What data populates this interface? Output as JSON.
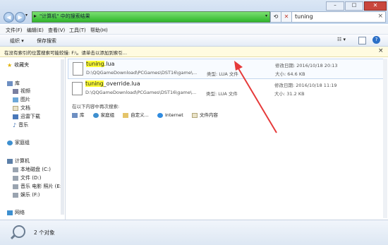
{
  "window": {
    "address_text": "\"计算机\" 中的搜索结果",
    "search_value": "tuning"
  },
  "menu": [
    "文件(F)",
    "编辑(E)",
    "查看(V)",
    "工具(T)",
    "帮助(H)"
  ],
  "toolbar": {
    "organize": "组织 ▾",
    "save_search": "保存搜索"
  },
  "infobar": {
    "message": "在没有索引的位置搜索可能较慢: F:\\。请单击以添加到索引...",
    "close": "×"
  },
  "sidebar": {
    "favorites": "收藏夹",
    "library": "库",
    "library_items": [
      "视频",
      "图片",
      "文档",
      "迅雷下载",
      "音乐"
    ],
    "homegroup": "家庭组",
    "computer": "计算机",
    "drives": [
      "本地磁盘 (C:)",
      "文件 (D:)",
      "音乐 电影 照片 (E:)",
      "娱乐 (F:)"
    ],
    "network": "网络"
  },
  "results": [
    {
      "name_highlight": "tuning",
      "name_rest": ".lua",
      "path": "D:\\QQGameDownload\\PCGames\\DST16\\game\\...",
      "type_label": "类型:",
      "type": "LUA 文件",
      "modified_label": "修改日期:",
      "modified": "2016/10/18 20:13",
      "size_label": "大小:",
      "size": "64.6 KB"
    },
    {
      "name_highlight": "tuning",
      "name_rest": "_override.lua",
      "path": "D:\\QQGameDownload\\PCGames\\DST16\\game\\...",
      "type_label": "类型:",
      "type": "LUA 文件",
      "modified_label": "修改日期:",
      "modified": "2016/10/18 11:19",
      "size_label": "大小:",
      "size": "31.2 KB"
    }
  ],
  "search_again": {
    "title": "在以下内容中再次搜索:",
    "options": [
      "库",
      "家庭组",
      "自定义...",
      "Internet",
      "文件内容"
    ]
  },
  "status": {
    "count": "2 个对象"
  },
  "colors": {
    "address_bar": "#2fb52a",
    "highlight": "#ffff33",
    "arrow": "#e63a3a"
  }
}
